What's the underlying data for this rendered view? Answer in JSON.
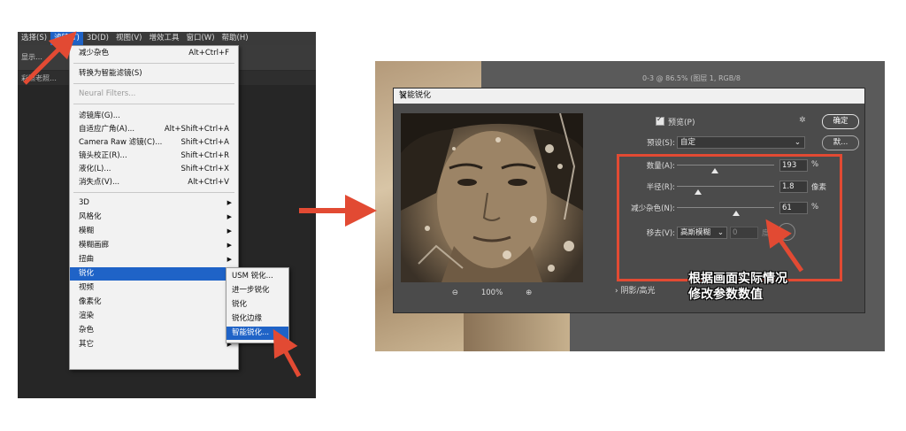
{
  "menubar": {
    "items": [
      "选择(S)",
      "滤镜(T)",
      "3D(D)",
      "视图(V)",
      "增效工具",
      "窗口(W)",
      "帮助(H)"
    ],
    "active_index": 1
  },
  "left_toolbar_fragment": {
    "label": "显示…"
  },
  "left_doc_fragment": {
    "label": "彩照老照…"
  },
  "filter_menu": {
    "items": [
      {
        "label": "减少杂色",
        "shortcut": "Alt+Ctrl+F"
      },
      {
        "label": "转换为智能滤镜(S)",
        "shortcut": ""
      },
      {
        "label": "Neural Filters...",
        "shortcut": "",
        "disabled": true
      },
      {
        "label": "滤镜库(G)...",
        "shortcut": ""
      },
      {
        "label": "自适应广角(A)...",
        "shortcut": "Alt+Shift+Ctrl+A"
      },
      {
        "label": "Camera Raw 滤镜(C)...",
        "shortcut": "Shift+Ctrl+A"
      },
      {
        "label": "镜头校正(R)...",
        "shortcut": "Shift+Ctrl+R"
      },
      {
        "label": "液化(L)...",
        "shortcut": "Shift+Ctrl+X"
      },
      {
        "label": "消失点(V)...",
        "shortcut": "Alt+Ctrl+V"
      },
      {
        "label": "3D",
        "submenu": true
      },
      {
        "label": "风格化",
        "submenu": true
      },
      {
        "label": "模糊",
        "submenu": true
      },
      {
        "label": "模糊画廊",
        "submenu": true
      },
      {
        "label": "扭曲",
        "submenu": true
      },
      {
        "label": "锐化",
        "submenu": true,
        "highlighted": true
      },
      {
        "label": "视频",
        "submenu": true
      },
      {
        "label": "像素化",
        "submenu": true
      },
      {
        "label": "渲染",
        "submenu": true
      },
      {
        "label": "杂色",
        "submenu": true
      },
      {
        "label": "其它",
        "submenu": true
      }
    ]
  },
  "sharpen_submenu": {
    "items": [
      "USM 锐化...",
      "进一步锐化",
      "锐化",
      "锐化边缘",
      "智能锐化..."
    ],
    "highlighted_index": 4
  },
  "bg_doc_title": {
    "label": "0-3 @ 86.5% (图层 1, RGB/8"
  },
  "dialog": {
    "title": "智能锐化",
    "close_glyph": "×",
    "preview_label": "预览(P)",
    "ok_label": "确定",
    "defaults_label": "默...",
    "zoom_out_glyph": "⊖",
    "zoom_in_glyph": "⊕",
    "zoom_level": "100%",
    "preset_label": "预设(S):",
    "preset_value": "自定",
    "amount_label": "数量(A):",
    "amount_value": "193",
    "amount_unit": "%",
    "amount_fraction": 0.39,
    "radius_label": "半径(R):",
    "radius_value": "1.8",
    "radius_unit": "像素",
    "radius_fraction": 0.22,
    "noise_label": "减少杂色(N):",
    "noise_value": "61",
    "noise_unit": "%",
    "noise_fraction": 0.61,
    "remove_label": "移去(V):",
    "remove_value": "高斯模糊",
    "angle_value": "0",
    "angle_unit": "度",
    "shadow_label": "阴影/高光"
  },
  "annotation": {
    "line1": "根据画面实际情况",
    "line2": "修改参数数值"
  },
  "colors": {
    "accent_red": "#e24a33",
    "menu_highlight": "#1f63c7"
  }
}
